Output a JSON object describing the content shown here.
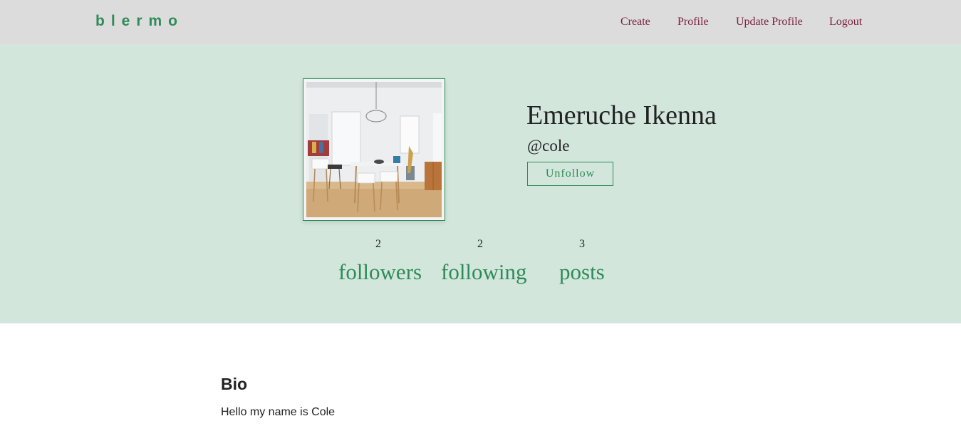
{
  "navbar": {
    "brand": "blermo",
    "links": [
      "Create",
      "Profile",
      "Update Profile",
      "Logout"
    ]
  },
  "profile": {
    "name": "Emeruche Ikenna",
    "handle": "@cole",
    "follow_button": "Unfollow",
    "avatar_icon": "room-photo"
  },
  "stats": [
    {
      "count": "2",
      "label": "followers"
    },
    {
      "count": "2",
      "label": "following"
    },
    {
      "count": "3",
      "label": "posts"
    }
  ],
  "bio": {
    "title": "Bio",
    "text": "Hello my name is Cole"
  },
  "colors": {
    "accent": "#2e8b57",
    "nav_link": "#7a1f3d",
    "navbar_bg": "#dcdcdc",
    "hero_bg": "#d2e6dc"
  }
}
